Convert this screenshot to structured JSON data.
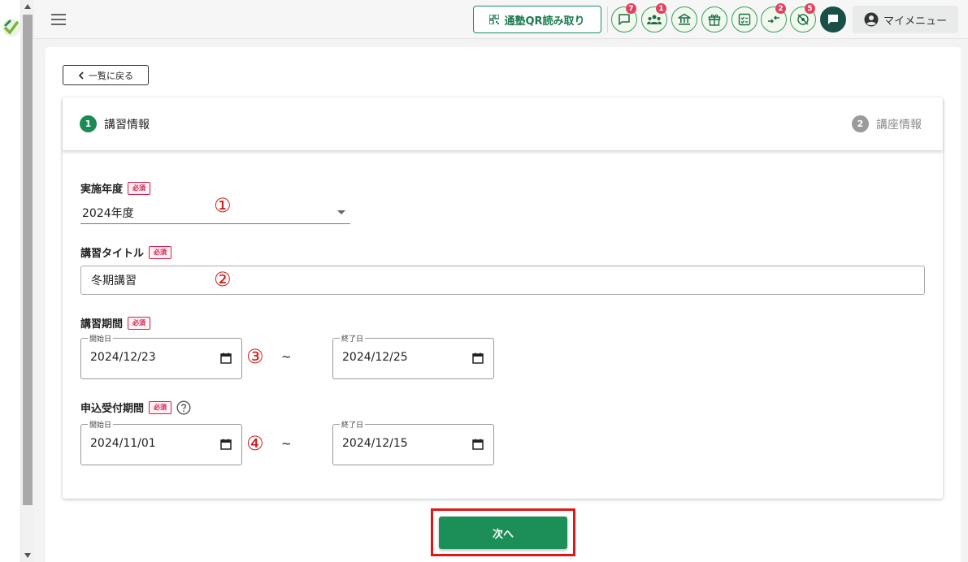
{
  "header": {
    "qr_button_label": "通塾QR読み取り",
    "icons": [
      {
        "name": "message-icon",
        "badge": "7"
      },
      {
        "name": "group-icon",
        "badge": "1"
      },
      {
        "name": "bank-icon",
        "badge": ""
      },
      {
        "name": "gift-icon",
        "badge": ""
      },
      {
        "name": "checklist-icon",
        "badge": ""
      },
      {
        "name": "transfer-icon",
        "badge": "2"
      },
      {
        "name": "location-off-icon",
        "badge": "5"
      },
      {
        "name": "chat-icon",
        "badge": ""
      }
    ],
    "my_menu_label": "マイメニュー"
  },
  "back_button_label": "一覧に戻る",
  "steps": [
    {
      "number": "1",
      "label": "講習情報",
      "active": true
    },
    {
      "number": "2",
      "label": "講座情報",
      "active": false
    }
  ],
  "required_label": "必須",
  "form": {
    "year": {
      "label": "実施年度",
      "value": "2024年度"
    },
    "title": {
      "label": "講習タイトル",
      "value": "冬期講習"
    },
    "period": {
      "label": "講習期間",
      "start_legend": "開始日",
      "start": "2024/12/23",
      "end_legend": "終了日",
      "end": "2024/12/25"
    },
    "application": {
      "label": "申込受付期間",
      "start_legend": "開始日",
      "start": "2024/11/01",
      "end_legend": "終了日",
      "end": "2024/12/15"
    },
    "range_separator": "~"
  },
  "annotations": [
    "①",
    "②",
    "③",
    "④"
  ],
  "next_button_label": "次へ",
  "colors": {
    "primary": "#1c8e58",
    "required": "#d01f4c",
    "highlight": "#e01717"
  }
}
